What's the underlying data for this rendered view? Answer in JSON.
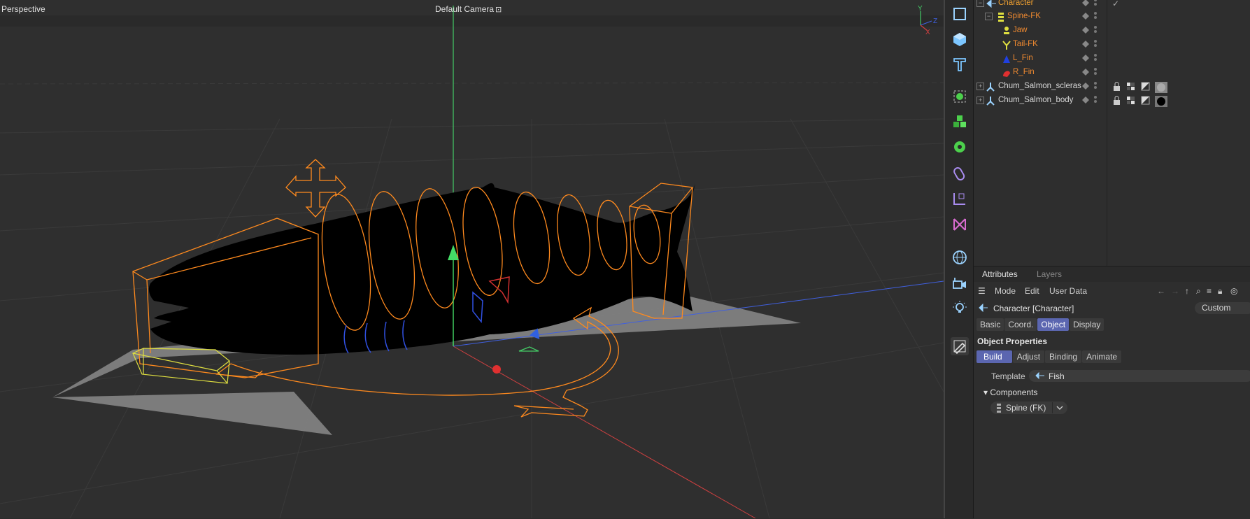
{
  "viewport": {
    "title": "Perspective",
    "camera": "Default Camera",
    "axis_labels": {
      "y": "Y",
      "z": "Z",
      "x": "X"
    }
  },
  "toolstrip": {
    "tools": [
      {
        "name": "cube-outline-icon",
        "color": "#9bd3ff"
      },
      {
        "name": "cube-icon",
        "color": "#7cc6ff"
      },
      {
        "name": "text-icon",
        "color": "#7cc6ff"
      },
      {
        "name": "subdivision-icon",
        "color": "#4cd04c"
      },
      {
        "name": "cloner-icon",
        "color": "#4cd04c"
      },
      {
        "name": "deformer-gear-icon",
        "color": "#4cd04c"
      },
      {
        "name": "spline-pen-icon",
        "color": "#a98cf0"
      },
      {
        "name": "coordinate-icon",
        "color": "#a98cf0"
      },
      {
        "name": "effector-icon",
        "color": "#d96cd0"
      },
      {
        "name": "globe-icon",
        "color": "#9bd3ff"
      },
      {
        "name": "camera-icon",
        "color": "#9bd3ff"
      },
      {
        "name": "light-icon",
        "color": "#9bd3ff"
      },
      {
        "name": "brush-icon",
        "color": "#dddddd"
      }
    ]
  },
  "object_manager": {
    "rows": [
      {
        "label": "Character",
        "color": "#f0a030",
        "icon": "character-icon"
      },
      {
        "label": "Spine-FK",
        "color": "#f08a30",
        "icon": "spine-icon"
      },
      {
        "label": "Jaw",
        "color": "#f08a30",
        "icon": "joint-icon"
      },
      {
        "label": "Tail-FK",
        "color": "#f08a30",
        "icon": "tail-icon"
      },
      {
        "label": "L_Fin",
        "color": "#f08a30",
        "icon": "fin-left-icon"
      },
      {
        "label": "R_Fin",
        "color": "#f08a30",
        "icon": "fin-right-icon"
      },
      {
        "label": "Chum_Salmon_scleras",
        "color": "#d8d8d8",
        "icon": "mesh-icon"
      },
      {
        "label": "Chum_Salmon_body",
        "color": "#d8d8d8",
        "icon": "mesh-icon"
      }
    ]
  },
  "attributes": {
    "tabs": [
      "Attributes",
      "Layers"
    ],
    "menu": [
      "Mode",
      "Edit",
      "User Data"
    ],
    "object_name": "Character [Character]",
    "custom_label": "Custom",
    "pages": [
      "Basic",
      "Coord.",
      "Object",
      "Display"
    ],
    "active_page": "Object",
    "section_title": "Object Properties",
    "subpages": [
      "Build",
      "Adjust",
      "Binding",
      "Animate"
    ],
    "active_subpage": "Build",
    "template_label": "Template",
    "template_value": "Fish",
    "components_label": "Components",
    "component_item": "Spine (FK)"
  },
  "colors": {
    "accent": "#5b66b0",
    "selection_orange": "#ff8a1e",
    "axis_y": "#44cc66",
    "axis_x": "#e04040",
    "axis_z": "#4060e0"
  }
}
